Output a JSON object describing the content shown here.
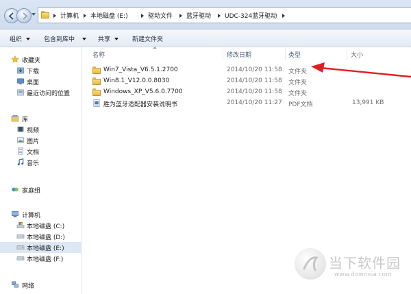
{
  "breadcrumb": {
    "items": [
      "计算机",
      "本地磁盘 (E:)",
      "驱动文件",
      "蓝牙驱动",
      "UDC-324蓝牙驱动"
    ]
  },
  "toolbar": {
    "organize": "组织",
    "include_in_library": "包含到库中",
    "share": "共享",
    "new_folder": "新建文件夹"
  },
  "nav": {
    "favorites": "收藏夹",
    "downloads": "下载",
    "desktop": "桌面",
    "recent": "最近访问的位置",
    "libraries": "库",
    "videos": "视频",
    "pictures": "图片",
    "documents": "文档",
    "music": "音乐",
    "homegroup": "家庭组",
    "computer": "计算机",
    "drive_c": "本地磁盘 (C:)",
    "drive_d": "本地磁盘 (D:)",
    "drive_e": "本地磁盘 (E:)",
    "drive_f": "本地磁盘 (F:)",
    "network": "网络"
  },
  "columns": {
    "name": "名称",
    "modified": "修改日期",
    "type": "类型",
    "size": "大小"
  },
  "files": [
    {
      "name": "Win7_Vista_V6.5.1.2700",
      "date": "2014/10/20 11:58",
      "type": "文件夹",
      "size": "",
      "icon": "folder-icon"
    },
    {
      "name": "Win8.1_V12.0.0.8030",
      "date": "2014/10/20 11:58",
      "type": "文件夹",
      "size": "",
      "icon": "folder-icon"
    },
    {
      "name": "Windows_XP_V5.6.0.7700",
      "date": "2014/10/20 11:58",
      "type": "文件夹",
      "size": "",
      "icon": "folder-icon"
    },
    {
      "name": "胜为蓝牙适配器安装说明书",
      "date": "2014/10/20 11:27",
      "type": "PDF文档",
      "size": "13,991 KB",
      "icon": "pdf-icon"
    }
  ],
  "watermark": {
    "text": "当下软件园",
    "url": "www.downxia.com"
  },
  "colors": {
    "annotation_arrow": "#e02020",
    "selection": "#dde8f5"
  }
}
